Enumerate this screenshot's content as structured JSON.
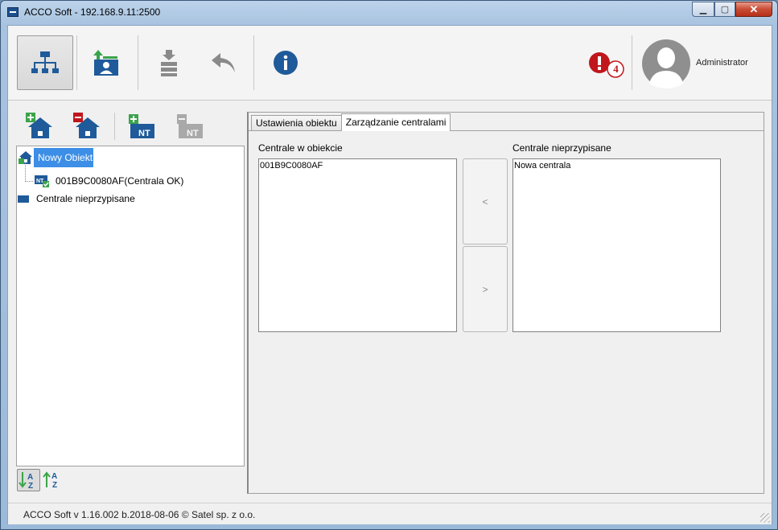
{
  "window": {
    "title": "ACCO Soft - 192.168.9.11:2500"
  },
  "toolbar": {
    "buttons": [
      {
        "icon": "tree-structure-icon",
        "active": true
      },
      {
        "icon": "user-upload-icon"
      },
      {
        "icon": "download-stack-icon"
      },
      {
        "icon": "undo-arrow-icon"
      },
      {
        "icon": "info-icon"
      }
    ],
    "alert_count": "4",
    "user_name": "Administrator",
    "colors": {
      "accent": "#1f5a9a",
      "alert": "#c0161c"
    }
  },
  "left_panel": {
    "tools": [
      "add-object-icon",
      "remove-object-icon",
      "add-panel-icon",
      "remove-panel-icon"
    ],
    "tree": {
      "root_label": "Nowy Obiekt",
      "child_label": "001B9C0080AF(Centrala OK)",
      "unassigned_label": "Centrale nieprzypisane"
    },
    "sort": [
      "sort-az-desc-icon",
      "sort-az-asc-icon"
    ]
  },
  "right_panel": {
    "tabs": [
      {
        "label": "Ustawienia obiektu",
        "selected": false
      },
      {
        "label": "Zarządzanie centralami",
        "selected": true
      }
    ],
    "assigned": {
      "label": "Centrale w obiekcie",
      "items": [
        "001B9C0080AF"
      ]
    },
    "unassigned": {
      "label": "Centrale nieprzypisane",
      "items": [
        "Nowa centrala"
      ]
    },
    "move_left_label": "<",
    "move_right_label": ">"
  },
  "status": {
    "text": "ACCO Soft v 1.16.002 b.2018-08-06   © Satel sp. z o.o."
  }
}
